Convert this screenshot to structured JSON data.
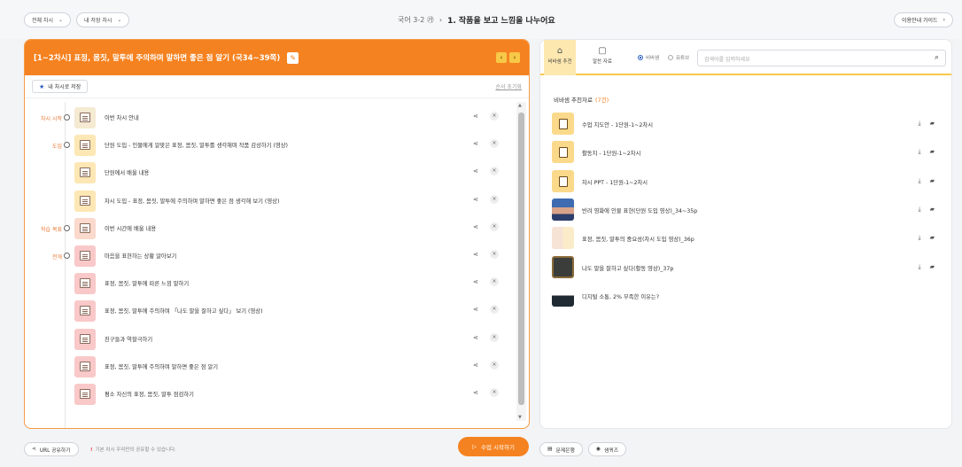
{
  "topbar": {
    "select_period": "전체 차시",
    "select_saved": "내 저장 차시",
    "breadcrumb_subject": "국어 3-2 ㉮",
    "breadcrumb_current": "1. 작품을 보고 느낌을 나누어요",
    "guide_label": "이용안내 가이드"
  },
  "lesson": {
    "title": "[1~2차시] 표정, 몸짓, 말투에 주의하며 말하면 좋은 점 알기 (국34~39쪽)",
    "save_label": "내 차시로 저장",
    "reset_label": "순서 초기화",
    "rows": [
      {
        "stage": "차시 시작",
        "title": "이번 차시 안내",
        "color": "#f5ead2"
      },
      {
        "stage": "도입",
        "title": "단원 도입 - 인물에게 알맞은 표정, 몸짓, 말투를 생각해며 작품 감상하기 (영상)",
        "color": "#fde7b4"
      },
      {
        "stage": "",
        "title": "단원에서 배울 내용",
        "color": "#fde7b4"
      },
      {
        "stage": "",
        "title": "차시 도입 - 표정, 몸짓, 말투에 주의하며 말하면 좋은 점 생각해 보기 (영상)",
        "color": "#fde7b4"
      },
      {
        "stage": "학습 목표",
        "title": "이번 시간에 배울 내용",
        "color": "#fbd9cc"
      },
      {
        "stage": "전개",
        "title": "마음을 표현하는 상황 알아보기",
        "color": "#f9c8c8"
      },
      {
        "stage": "",
        "title": "표정, 몸짓, 말투에 따른 느낌 말하기",
        "color": "#f9c8c8"
      },
      {
        "stage": "",
        "title": "표정, 몸짓, 말투에 주의하며 「나도 말을 잘하고 싶다」 보기 (영상)",
        "color": "#f9c8c8"
      },
      {
        "stage": "",
        "title": "친구들과 역할극하기",
        "color": "#f9c8c8"
      },
      {
        "stage": "",
        "title": "표정, 몸짓, 말투에 주의하며 말하면 좋은 점 알기",
        "color": "#f9c8c8"
      },
      {
        "stage": "",
        "title": "평소 자신의 표정, 몸짓, 말투 점검하기",
        "color": "#f9c8c8"
      }
    ]
  },
  "panel": {
    "tab_recommend": "비바샘 추천",
    "tab_my": "알찬 자료",
    "radio_vivasam": "비바샘",
    "radio_youtube": "유튜브",
    "search_placeholder": "검색어를 입력하세요",
    "section_title": "비바샘 추천자료",
    "section_count": "(7건)",
    "resources": [
      {
        "title": "수업 지도안 - 1단원-1~2차시",
        "thumb": "doc",
        "actions": true
      },
      {
        "title": "활동지 - 1단원-1~2차시",
        "thumb": "doc",
        "actions": true
      },
      {
        "title": "차시 PPT - 1단원-1~2차시",
        "thumb": "doc",
        "actions": true
      },
      {
        "title": "반려 영화에 인물 표현(단원 도입 영상)_34~35p",
        "thumb": "p1",
        "actions": true
      },
      {
        "title": "표정, 몸짓, 말투의 중요성(차시 도입 영상)_36p",
        "thumb": "p2",
        "actions": true
      },
      {
        "title": "나도 말을 잘하고 싶다(활동 영상)_37p",
        "thumb": "p3",
        "actions": true
      },
      {
        "title": "디지털 소통, 2% 부족한 이유는?",
        "thumb": "p4",
        "actions": false
      }
    ]
  },
  "bottom": {
    "url_share": "URL 공유하기",
    "notice": "기본 차시 우리만의 공유할 수 있습니다.",
    "start": "수업 시작하기",
    "doc_btn": "문제은행",
    "quiz_btn": "샘퀴즈"
  }
}
